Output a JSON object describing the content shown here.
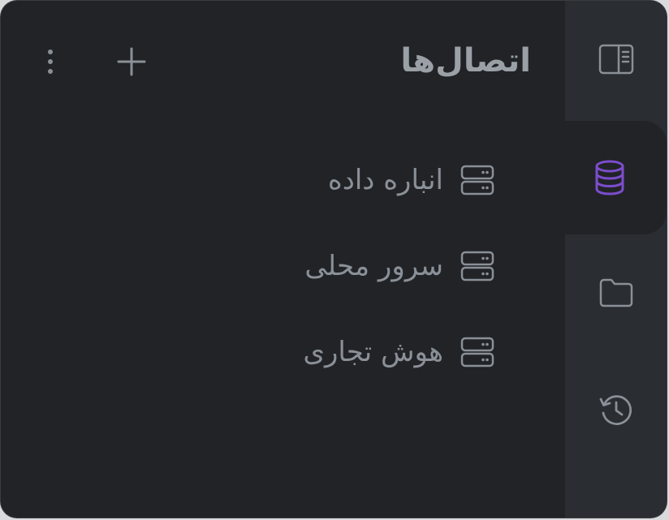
{
  "panel": {
    "title": "اتصال‌ها",
    "add_icon": "plus-icon",
    "more_icon": "more-vertical-icon"
  },
  "connections": [
    {
      "label": "انباره داده",
      "icon": "server-icon"
    },
    {
      "label": "سرور محلی",
      "icon": "server-icon"
    },
    {
      "label": "هوش تجاری",
      "icon": "server-icon"
    }
  ],
  "rail": {
    "items": [
      {
        "name": "toggle-sidebar",
        "icon": "sidebar-panel-icon",
        "active": false
      },
      {
        "name": "connections",
        "icon": "database-icon",
        "active": true
      },
      {
        "name": "files",
        "icon": "folder-icon",
        "active": false
      },
      {
        "name": "history",
        "icon": "history-icon",
        "active": false
      }
    ]
  },
  "colors": {
    "background": "#212327",
    "rail": "#2a2d31",
    "text": "#8a9097",
    "accent": "#7c4dcc"
  }
}
